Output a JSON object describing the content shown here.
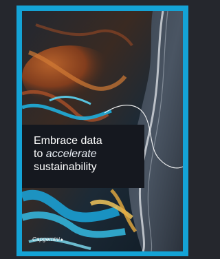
{
  "cover": {
    "headline": {
      "line1": "Embrace data",
      "line2_prefix": "to",
      "line2_accent": "accelerate",
      "line3": "sustainability"
    },
    "brand": {
      "name": "Capgemini",
      "icon": "spade-icon"
    }
  },
  "colors": {
    "page_background": "#25272d",
    "frame_border": "#14a3d6",
    "headline_background": "#15181f",
    "headline_text": "#ffffff"
  }
}
